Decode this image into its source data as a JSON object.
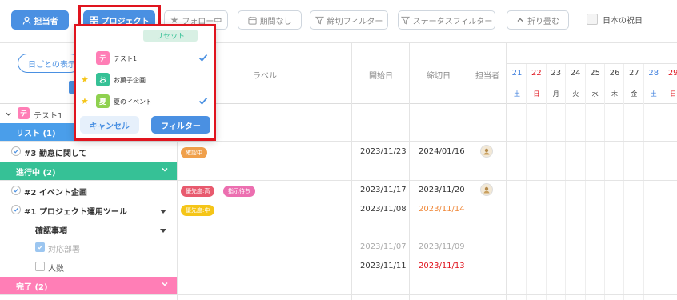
{
  "toolbar": {
    "assignee": "担当者",
    "project": "プロジェクト",
    "following": "フォロー中",
    "no_period": "期間なし",
    "deadline_filter": "締切フィルター",
    "status_filter": "ステータスフィルター",
    "collapse": "折り畳む",
    "japan_holidays": "日本の祝日"
  },
  "left_panel": {
    "daily_display": "日ごとの表示"
  },
  "columns": {
    "label": "ラベル",
    "start_date": "開始日",
    "due_date": "締切日",
    "assignee": "担当者"
  },
  "calendar": {
    "days": [
      "21",
      "22",
      "23",
      "24",
      "25",
      "26",
      "27",
      "28",
      "29"
    ],
    "weekdays": [
      "土",
      "日",
      "月",
      "火",
      "水",
      "木",
      "金",
      "土",
      "日"
    ]
  },
  "project_group": {
    "icon_char": "テ",
    "name": "テスト1"
  },
  "groups": {
    "list": {
      "label": "リスト (1)",
      "color": "#4a9eea"
    },
    "in_progress": {
      "label": "進行中 (2)",
      "color": "#36c196"
    },
    "done": {
      "label": "完了 (2)",
      "color": "#ff7eb6"
    }
  },
  "tasks": [
    {
      "title": "#3 勤怠に関して",
      "labels": [
        "確認中"
      ],
      "start": "2023/11/23",
      "due": "2024/01/16"
    },
    {
      "title": "#2 イベント企画",
      "labels": [
        "優先度:高",
        "指示待ち"
      ],
      "start": "2023/11/17",
      "due": "2023/11/20"
    },
    {
      "title": "#1 プロジェクト運用ツール",
      "labels": [
        "優先度:中"
      ],
      "start": "2023/11/08",
      "due": "2023/11/14"
    }
  ],
  "subitems": {
    "header": "確認事項",
    "items": [
      {
        "label": "対応部署",
        "checked": true,
        "start": "2023/11/07",
        "due": "2023/11/09"
      },
      {
        "label": "人数",
        "checked": false,
        "start": "2023/11/11",
        "due": "2023/11/13"
      }
    ]
  },
  "project_popup": {
    "reset": "リセット",
    "projects": [
      {
        "icon": "テ",
        "name": "テスト1",
        "color": "#ff7eb6",
        "favorite": false,
        "selected": true
      },
      {
        "icon": "お",
        "name": "お菓子企画",
        "color": "#36c196",
        "favorite": true,
        "selected": false
      },
      {
        "icon": "夏",
        "name": "夏のイベント",
        "color": "#8fd14f",
        "favorite": true,
        "selected": true
      }
    ],
    "cancel": "キャンセル",
    "filter": "フィルター"
  },
  "colors": {
    "accent": "#4a90e2",
    "overdue_orange": "#f08a3c",
    "overdue_red": "#e0141e",
    "badge_orange": "#f0a04b",
    "badge_red": "#e85a6e",
    "badge_pink": "#ec6fb0",
    "badge_yellow": "#f5c518"
  }
}
